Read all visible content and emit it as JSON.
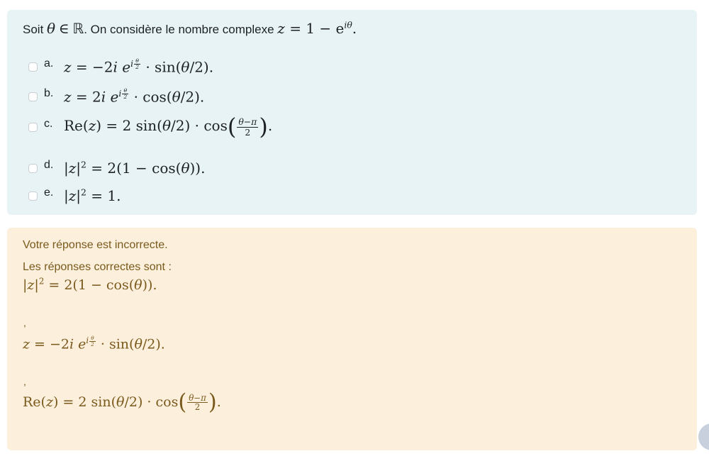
{
  "question": {
    "intro": "Soit",
    "theta": "θ",
    "in_symbol": "∈",
    "reals": "ℝ",
    "sentence": ". On considère le nombre complexe",
    "formula_lhs": "z",
    "formula_rest": " = 1 − e",
    "formula_exp": "iθ",
    "formula_end": "."
  },
  "options": [
    {
      "letter": "a.",
      "checked": false
    },
    {
      "letter": "b.",
      "checked": false
    },
    {
      "letter": "c.",
      "checked": false
    },
    {
      "letter": "d.",
      "checked": false
    },
    {
      "letter": "e.",
      "checked": false
    }
  ],
  "feedback": {
    "message": "Votre réponse est incorrecte.",
    "correct_title": "Les réponses correctes sont :",
    "separator": ","
  }
}
